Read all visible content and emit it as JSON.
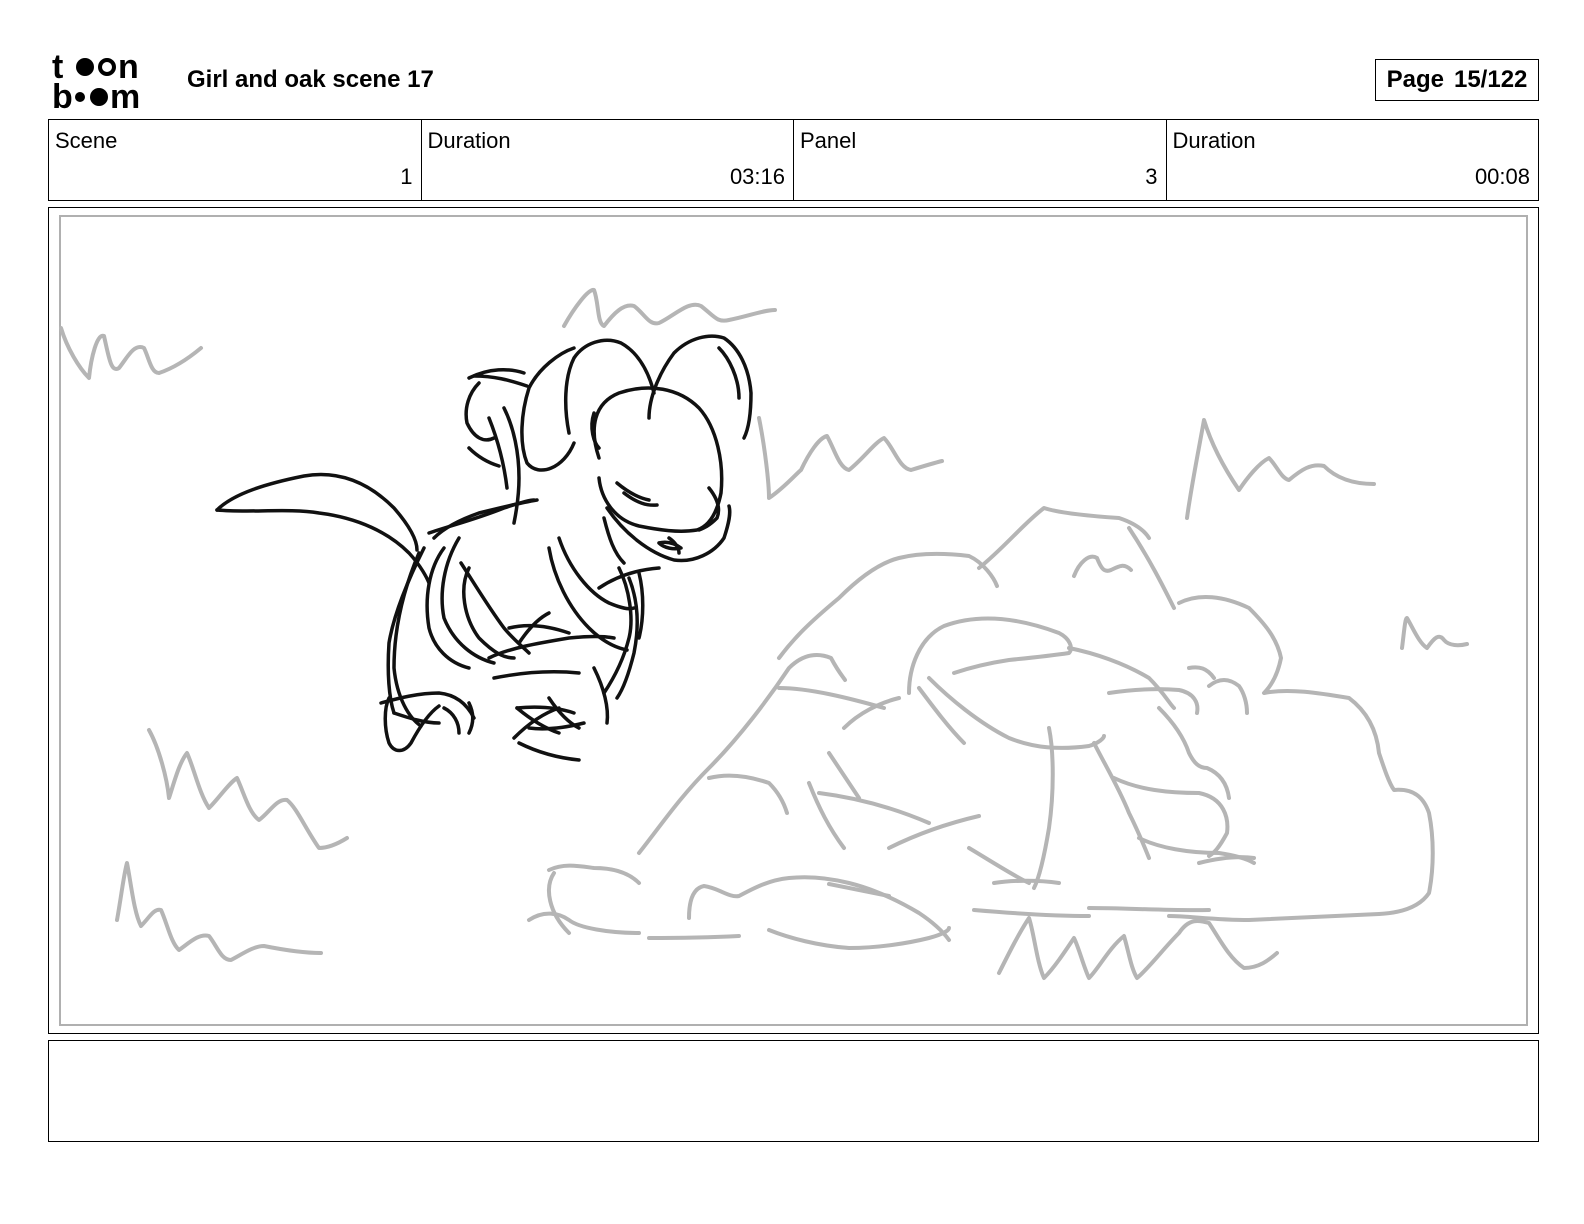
{
  "header": {
    "logo_icon": "toon-boom-logo",
    "title": "Girl and oak scene 17",
    "page_label": "Page",
    "page_value": "15/122"
  },
  "info": {
    "scene_label": "Scene",
    "scene_value": "1",
    "duration_label": "Duration",
    "duration_value": "03:16",
    "panel_label": "Panel",
    "panel_value": "3",
    "panel_duration_label": "Duration",
    "panel_duration_value": "00:08"
  },
  "panel": {
    "sketch_icon": "storyboard-sketch-mouse-and-rocks",
    "ink_color": "#111111",
    "background_ink_color": "#b5b5b5"
  },
  "notes": {
    "text": ""
  }
}
